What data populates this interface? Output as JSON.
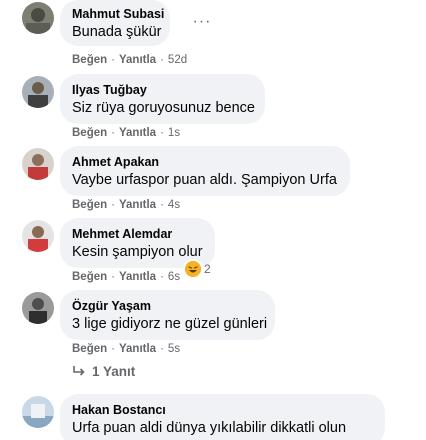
{
  "comments": [
    {
      "author": "Mahmut Subasi",
      "text": "Bunada şükür",
      "like": "Beğen",
      "reply": "Yanıtla",
      "time": "52d"
    },
    {
      "author": "Ilyas Tuğbay",
      "text": "Siz rüya goruyosunuz bence",
      "like": "Beğen",
      "reply": "Yanıtla",
      "time": "1s"
    },
    {
      "author": "Ahmet Apakan",
      "text": "Vaybe urfaspor puan aldı. Şampiyon Urfa",
      "like": "Beğen",
      "reply": "Yanıtla",
      "time": "4s"
    },
    {
      "author": "Mehmet Alemdar",
      "text": "Kesin şampiyon olur",
      "like": "Beğen",
      "reply": "Yanıtla",
      "time": "6s",
      "reaction_count": "2",
      "reaction_icon": "haha-emoji-icon"
    },
    {
      "author": "Özgür Yaşam",
      "text": "3 lige gidiyorz ne güzel günleri",
      "like": "Beğen",
      "reply": "Yanıtla",
      "time": "5s"
    },
    {
      "author": "Hakan Bostancı",
      "text": "Urfa puan aldi dünya yıkılabilir dikkatli olun"
    }
  ],
  "more_options": "···",
  "replies_link": {
    "label": "1 Yanıt",
    "icon": "reply-arrow-icon"
  },
  "colors": {
    "bubble": "#f0f2f5",
    "meta": "#65676b",
    "text": "#050505",
    "reaction": "#f7b125"
  }
}
